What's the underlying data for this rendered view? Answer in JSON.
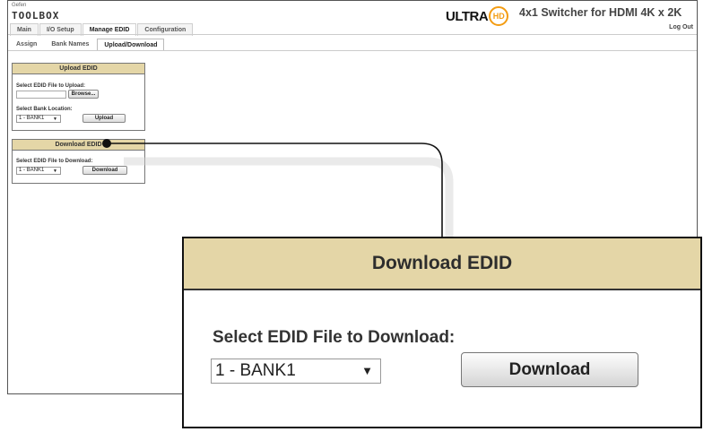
{
  "brand": {
    "sub": "Gefen",
    "main": "TOOLBOX"
  },
  "ultrahd": {
    "ultra": "ULTRA",
    "hd": "HD"
  },
  "product_title": "4x1 Switcher for HDMI 4K x 2K",
  "logout": "Log Out",
  "tabs": [
    {
      "label": "Main"
    },
    {
      "label": "I/O Setup"
    },
    {
      "label": "Manage EDID",
      "active": true
    },
    {
      "label": "Configuration"
    }
  ],
  "subtabs": [
    {
      "label": "Assign"
    },
    {
      "label": "Bank Names"
    },
    {
      "label": "Upload/Download",
      "active": true
    }
  ],
  "upload_panel": {
    "title": "Upload EDID",
    "file_label": "Select EDID File to Upload:",
    "browse_label": "Browse...",
    "bank_label": "Select Bank Location:",
    "bank_value": "1 - BANK1",
    "upload_label": "Upload"
  },
  "download_panel": {
    "title": "Download EDID",
    "file_label": "Select EDID File to Download:",
    "bank_value": "1 - BANK1",
    "download_label": "Download"
  },
  "zoom": {
    "title": "Download EDID",
    "file_label": "Select EDID File to Download:",
    "bank_value": "1 - BANK1",
    "download_label": "Download"
  },
  "colors": {
    "panel_header": "#e4d6a7",
    "accent_orange": "#f39c12"
  }
}
